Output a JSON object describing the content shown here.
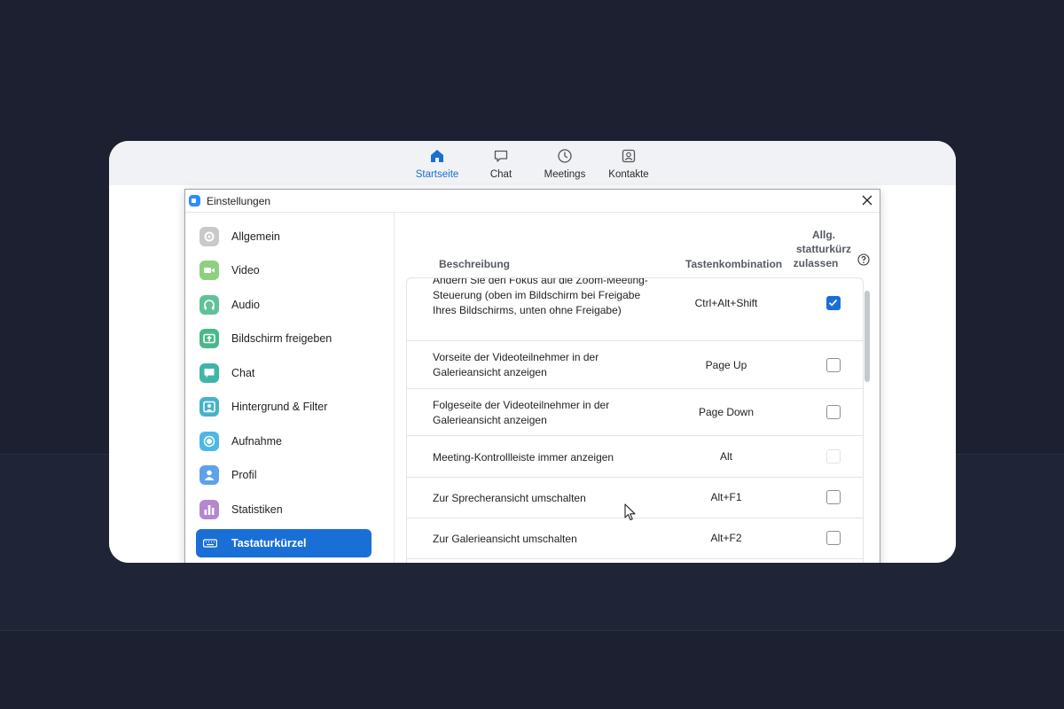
{
  "topnav": {
    "items": [
      {
        "label": "Startseite",
        "icon": "home-icon",
        "active": true
      },
      {
        "label": "Chat",
        "icon": "chat-bubble-icon"
      },
      {
        "label": "Meetings",
        "icon": "clock-icon"
      },
      {
        "label": "Kontakte",
        "icon": "contact-card-icon"
      }
    ]
  },
  "dialog": {
    "title": "Einstellungen",
    "sidebar": {
      "items": [
        {
          "label": "Allgemein",
          "icon": "gear-icon",
          "color": "#c9c9cc"
        },
        {
          "label": "Video",
          "icon": "video-camera-icon",
          "color": "#8ed07f"
        },
        {
          "label": "Audio",
          "icon": "headphones-icon",
          "color": "#5fc29a"
        },
        {
          "label": "Bildschirm freigeben",
          "icon": "share-screen-icon",
          "color": "#49b98a"
        },
        {
          "label": "Chat",
          "icon": "chat-icon",
          "color": "#3fb5a8"
        },
        {
          "label": "Hintergrund & Filter",
          "icon": "portrait-icon",
          "color": "#46b3c8"
        },
        {
          "label": "Aufnahme",
          "icon": "record-icon",
          "color": "#4cb8e6"
        },
        {
          "label": "Profil",
          "icon": "person-icon",
          "color": "#5ea2ea"
        },
        {
          "label": "Statistiken",
          "icon": "bar-chart-icon",
          "color": "#b487cf"
        },
        {
          "label": "Tastaturkürzel",
          "icon": "keyboard-icon",
          "active": true
        }
      ]
    },
    "table": {
      "col_description": "Beschreibung",
      "col_shortcut": "Tastenkombination",
      "col_allow_line1": "Allg.",
      "col_allow_line2": "statturkürz",
      "col_allow_line3": "zulassen",
      "rows": [
        {
          "description": "Ändern Sie den Fokus auf die Zoom-Meeting-Steuerung (oben im Bildschirm bei Freigabe Ihres Bildschirms, unten ohne Freigabe)",
          "shortcut": "Ctrl+Alt+Shift",
          "checked": true
        },
        {
          "description": "Vorseite der Videoteilnehmer in der Galerieansicht anzeigen",
          "shortcut": "Page Up",
          "checked": false
        },
        {
          "description": "Folgeseite der Videoteilnehmer in der Galerieansicht anzeigen",
          "shortcut": "Page Down",
          "checked": false
        },
        {
          "description": "Meeting-Kontrollleiste immer anzeigen",
          "shortcut": "Alt",
          "checked": false,
          "disabled": true
        },
        {
          "description": "Zur Sprecheransicht umschalten",
          "shortcut": "Alt+F1",
          "checked": false
        },
        {
          "description": "Zur Galerieansicht umschalten",
          "shortcut": "Alt+F2",
          "checked": false
        }
      ]
    }
  }
}
